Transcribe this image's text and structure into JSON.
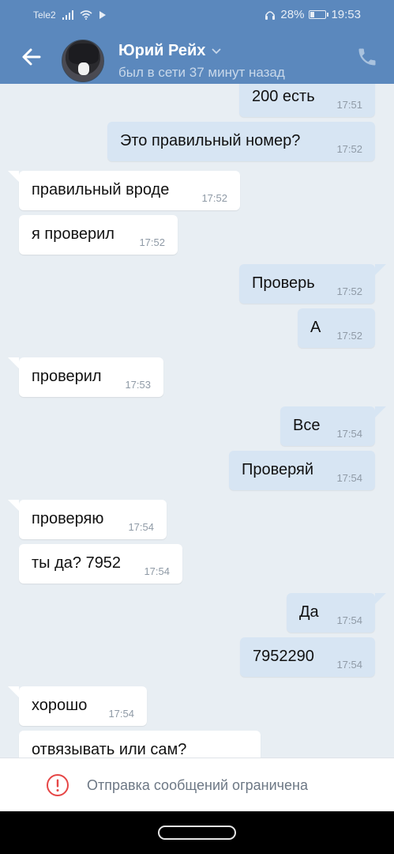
{
  "status_bar": {
    "carrier": "Tele2",
    "battery": "28%",
    "time": "19:53",
    "battery_level": 0.28,
    "icons": [
      "signal-icon",
      "wifi-icon",
      "play-icon",
      "headphones-icon",
      "battery-icon"
    ]
  },
  "header": {
    "name": "Юрий Рейх",
    "status": "был в сети 37 минут назад",
    "icons": [
      "back-arrow-icon",
      "chevron-down-icon",
      "phone-icon"
    ],
    "accent_color": "#5b88bd"
  },
  "messages": [
    {
      "dir": "out",
      "text": "200 есть",
      "time": "17:51"
    },
    {
      "dir": "out",
      "text": "Это правильный номер?",
      "time": "17:52"
    },
    {
      "dir": "in",
      "text": "правильный вроде",
      "time": "17:52"
    },
    {
      "dir": "in",
      "text": "я проверил",
      "time": "17:52"
    },
    {
      "dir": "out",
      "text": "Проверь",
      "time": "17:52"
    },
    {
      "dir": "out",
      "text": "А",
      "time": "17:52"
    },
    {
      "dir": "in",
      "text": "проверил",
      "time": "17:53"
    },
    {
      "dir": "out",
      "text": "Все",
      "time": "17:54"
    },
    {
      "dir": "out",
      "text": "Проверяй",
      "time": "17:54"
    },
    {
      "dir": "in",
      "text": "проверяю",
      "time": "17:54"
    },
    {
      "dir": "in",
      "text": "ты да? 7952",
      "time": "17:54"
    },
    {
      "dir": "out",
      "text": "Да",
      "time": "17:54"
    },
    {
      "dir": "out",
      "text": "7952290",
      "time": "17:54"
    },
    {
      "dir": "in",
      "text": "хорошо",
      "time": "17:54"
    },
    {
      "dir": "in",
      "text": "отвязывать или сам?",
      "time": ""
    }
  ],
  "footer": {
    "restriction_text": "Отправка сообщений ограничена",
    "warning_color": "#e64646"
  }
}
